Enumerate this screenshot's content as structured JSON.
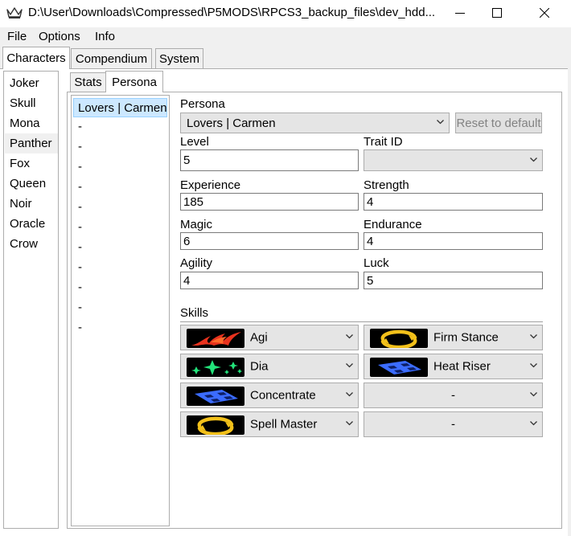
{
  "window": {
    "title": "D:\\User\\Downloads\\Compressed\\P5MODS\\RPCS3_backup_files\\dev_hdd...",
    "icon": "crown-icon",
    "controls": [
      "minimize-icon",
      "maximize-icon",
      "close-icon"
    ]
  },
  "menu": {
    "file": "File",
    "options": "Options",
    "info": "Info"
  },
  "main_tabs": {
    "characters": "Characters",
    "compendium": "Compendium",
    "system": "System"
  },
  "characters": [
    "Joker",
    "Skull",
    "Mona",
    "Panther",
    "Fox",
    "Queen",
    "Noir",
    "Oracle",
    "Crow"
  ],
  "selected_character": "Panther",
  "sub_tabs": {
    "stats": "Stats",
    "persona": "Persona"
  },
  "persona_list": [
    "Lovers | Carmen",
    "-",
    "-",
    "-",
    "-",
    "-",
    "-",
    "-",
    "-",
    "-",
    "-",
    "-",
    "-"
  ],
  "persona_form": {
    "persona_label": "Persona",
    "persona_value": "Lovers | Carmen",
    "reset_button": "Reset to default",
    "level_label": "Level",
    "level_value": "5",
    "trait_label": "Trait ID",
    "trait_value": "",
    "experience_label": "Experience",
    "experience_value": "185",
    "strength_label": "Strength",
    "strength_value": "4",
    "magic_label": "Magic",
    "magic_value": "6",
    "endurance_label": "Endurance",
    "endurance_value": "4",
    "agility_label": "Agility",
    "agility_value": "4",
    "luck_label": "Luck",
    "luck_value": "5",
    "skills_label": "Skills"
  },
  "skills": [
    {
      "name": "Agi",
      "icon": "fire-skill-icon"
    },
    {
      "name": "Firm Stance",
      "icon": "passive-ring-skill-icon"
    },
    {
      "name": "Dia",
      "icon": "healing-sparkle-skill-icon"
    },
    {
      "name": "Heat Riser",
      "icon": "support-grid-skill-icon"
    },
    {
      "name": "Concentrate",
      "icon": "support-grid-skill-icon"
    },
    {
      "name": "-",
      "icon": ""
    },
    {
      "name": "Spell Master",
      "icon": "passive-ring-skill-icon"
    },
    {
      "name": "-",
      "icon": ""
    }
  ],
  "colors": {
    "selection": "#cce8ff",
    "selection_border": "#99d1ff",
    "fire": "#e8321e",
    "heal": "#22e37a",
    "support": "#3b6cff",
    "passive": "#f2c01a"
  }
}
